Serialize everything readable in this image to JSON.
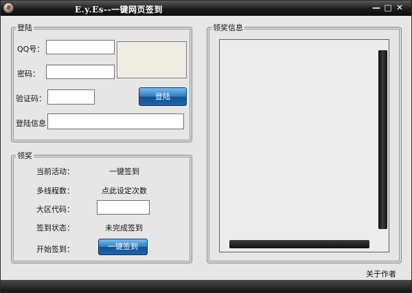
{
  "window": {
    "title": "E.y.Es--一键网页签到",
    "controls": {
      "minimize": "—",
      "maximize": "□",
      "close": "✕"
    }
  },
  "login": {
    "legend": "登陆",
    "qq_label": "QQ号：",
    "qq_value": "",
    "password_label": "密码：",
    "password_value": "",
    "captcha_label": "验证码：",
    "captcha_value": "",
    "login_button": "登陆",
    "info_label": "登陆信息：",
    "info_value": ""
  },
  "reward": {
    "legend": "领奖",
    "activity_label": "当前活动：",
    "activity_value": "一键签到",
    "threads_label": "多线程数：",
    "threads_value": "点此设定次数",
    "region_label": "大区代码：",
    "region_value": "",
    "status_label": "签到状态：",
    "status_value": "未完成签到",
    "start_label": "开始签到：",
    "start_button": "一键签到"
  },
  "reward_info": {
    "legend": "领奖信息"
  },
  "footer": {
    "about": "关于作者"
  },
  "icons": {
    "app": "app-logo-icon",
    "minimize": "minimize-icon",
    "maximize": "maximize-icon",
    "close": "close-icon"
  }
}
